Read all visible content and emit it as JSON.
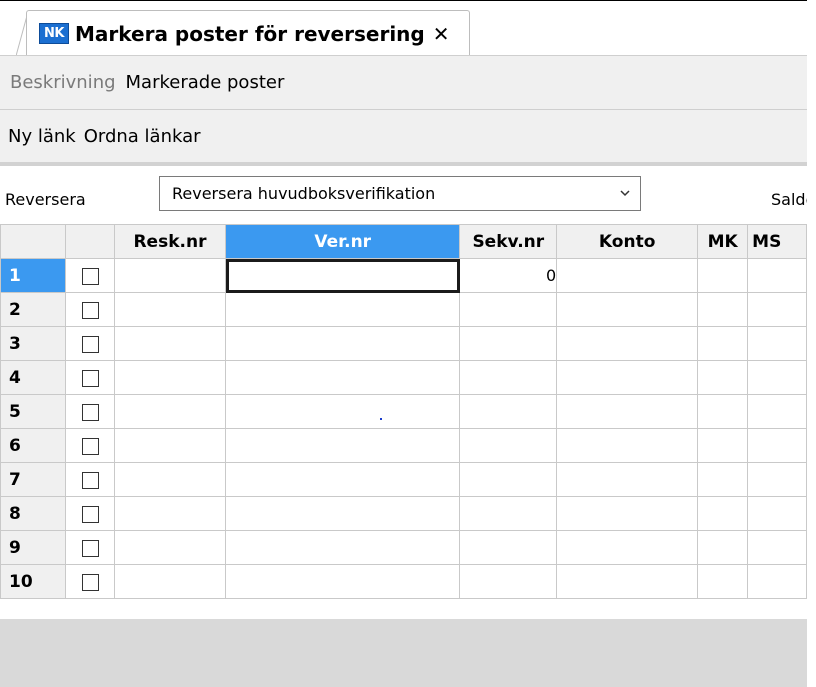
{
  "tab": {
    "icon_text": "NK",
    "title": "Markera poster för reversering",
    "close_glyph": "✕"
  },
  "menu": {
    "items": [
      "Beskrivning",
      "Markerade poster"
    ]
  },
  "links": {
    "items": [
      "Ny länk",
      "Ordna länkar"
    ]
  },
  "filter": {
    "label": "Reversera",
    "selected": "Reversera huvudboksverifikation",
    "saldo_label": "Saldo"
  },
  "grid": {
    "columns": [
      "",
      "",
      "Resk.nr",
      "Ver.nr",
      "Sekv.nr",
      "Konto",
      "MK",
      "MS"
    ],
    "rows": [
      {
        "num": "1",
        "sekv": "0"
      },
      {
        "num": "2",
        "sekv": ""
      },
      {
        "num": "3",
        "sekv": ""
      },
      {
        "num": "4",
        "sekv": ""
      },
      {
        "num": "5",
        "sekv": ""
      },
      {
        "num": "6",
        "sekv": ""
      },
      {
        "num": "7",
        "sekv": ""
      },
      {
        "num": "8",
        "sekv": ""
      },
      {
        "num": "9",
        "sekv": ""
      },
      {
        "num": "10",
        "sekv": ""
      }
    ]
  },
  "colors": {
    "accent": "#3b99f0",
    "icon_bg": "#1b6fd1"
  }
}
